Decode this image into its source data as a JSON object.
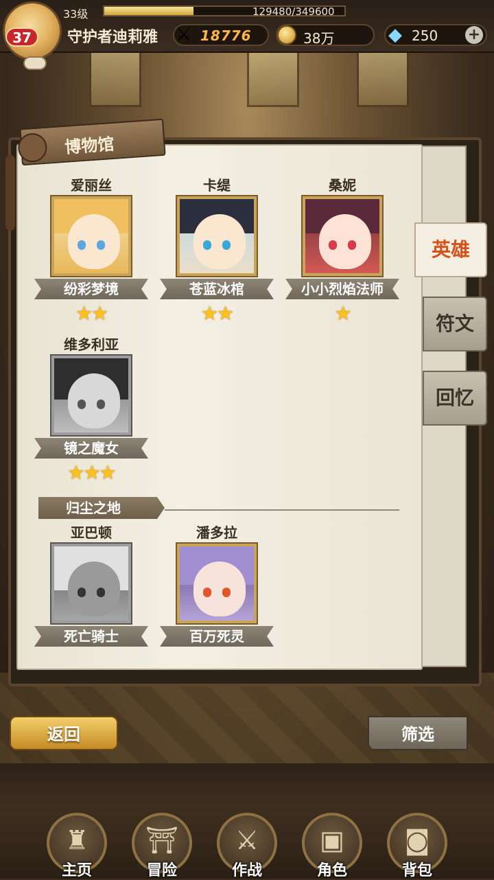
{
  "player": {
    "level_badge": "37",
    "level_text": "33级",
    "xp": "129480/349600",
    "xp_fraction": 0.37,
    "name": "守护者迪莉雅",
    "power": "18776",
    "gold": "38万",
    "gems": "250",
    "plus_label": "+"
  },
  "panel": {
    "title": "博物馆"
  },
  "heroes": [
    {
      "name": "爱丽丝",
      "title": "纷彩梦境",
      "stars": 2,
      "stars_text": "★★",
      "gray": false
    },
    {
      "name": "卡缇",
      "title": "苍蓝冰棺",
      "stars": 2,
      "stars_text": "★★",
      "gray": false
    },
    {
      "name": "桑妮",
      "title": "小小烈焰法师",
      "stars": 1,
      "stars_text": "★",
      "gray": false
    },
    {
      "name": "维多利亚",
      "title": "镜之魔女",
      "stars": 3,
      "stars_text": "★★★",
      "gray": true
    }
  ],
  "section": {
    "label": "归尘之地",
    "heroes": [
      {
        "name": "亚巴顿",
        "title": "死亡骑士",
        "gray": true
      },
      {
        "name": "潘多拉",
        "title": "百万死灵",
        "gray": false
      }
    ]
  },
  "tabs": [
    {
      "label": "英雄",
      "active": true
    },
    {
      "label": "符文",
      "active": false
    },
    {
      "label": "回忆",
      "active": false
    }
  ],
  "buttons": {
    "back": "返回",
    "filter": "筛选"
  },
  "nav": [
    {
      "label": "主页",
      "icon": "home-statue-icon"
    },
    {
      "label": "冒险",
      "icon": "portal-gate-icon"
    },
    {
      "label": "作战",
      "icon": "sword-girl-icon"
    },
    {
      "label": "角色",
      "icon": "book-icon"
    },
    {
      "label": "背包",
      "icon": "backpack-icon"
    }
  ],
  "colors": {
    "accent_tab": "#d8501a",
    "power": "#ffb640",
    "star": "#ffc21d",
    "level_badge": "#c8262b"
  }
}
